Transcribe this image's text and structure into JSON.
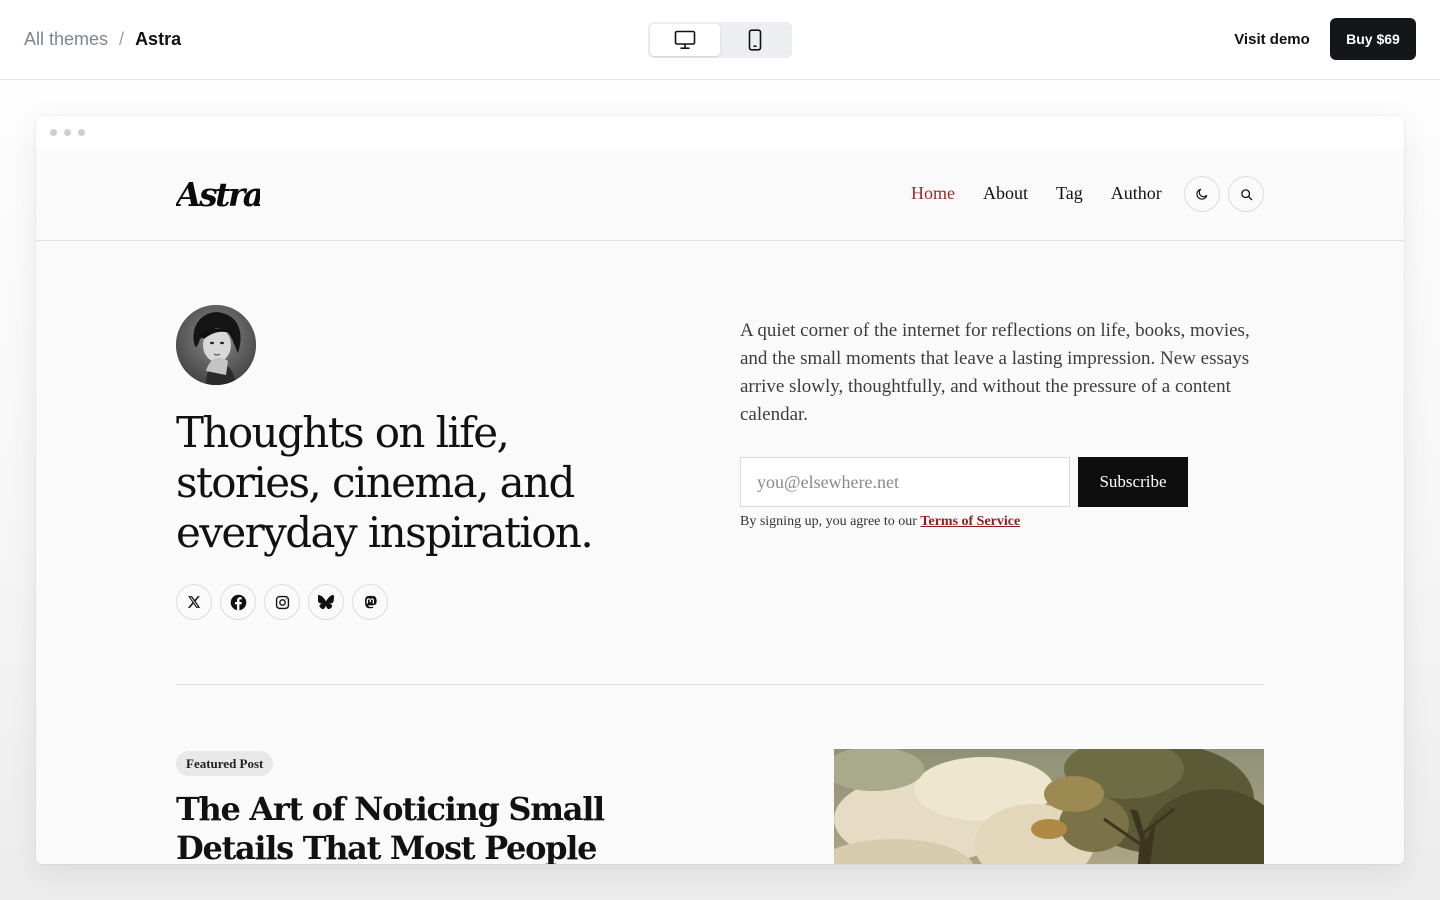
{
  "topbar": {
    "breadcrumb_root": "All themes",
    "breadcrumb_sep": "/",
    "breadcrumb_current": "Astra",
    "visit_demo": "Visit demo",
    "buy": "Buy $69"
  },
  "site": {
    "logo_text": "Astra",
    "nav": [
      "Home",
      "About",
      "Tag",
      "Author"
    ],
    "active_nav": "Home",
    "accent": "#a02a2a"
  },
  "hero": {
    "title": "Thoughts on life, stories, cinema, and everyday inspiration.",
    "intro": "A quiet corner of the internet for reflections on life, books, movies, and the small moments that leave a lasting impression. New essays arrive slowly, thoughtfully, and without the pressure of a content calendar.",
    "email_placeholder": "you@elsewhere.net",
    "subscribe": "Subscribe",
    "terms_prefix": "By signing up, you agree to our",
    "terms_link": "Terms of Service",
    "socials": [
      "x-icon",
      "facebook-icon",
      "instagram-icon",
      "bluesky-icon",
      "mastodon-icon"
    ]
  },
  "featured": {
    "badge": "Featured Post",
    "title": "The Art of Noticing Small Details That Most People Often Overlook"
  }
}
